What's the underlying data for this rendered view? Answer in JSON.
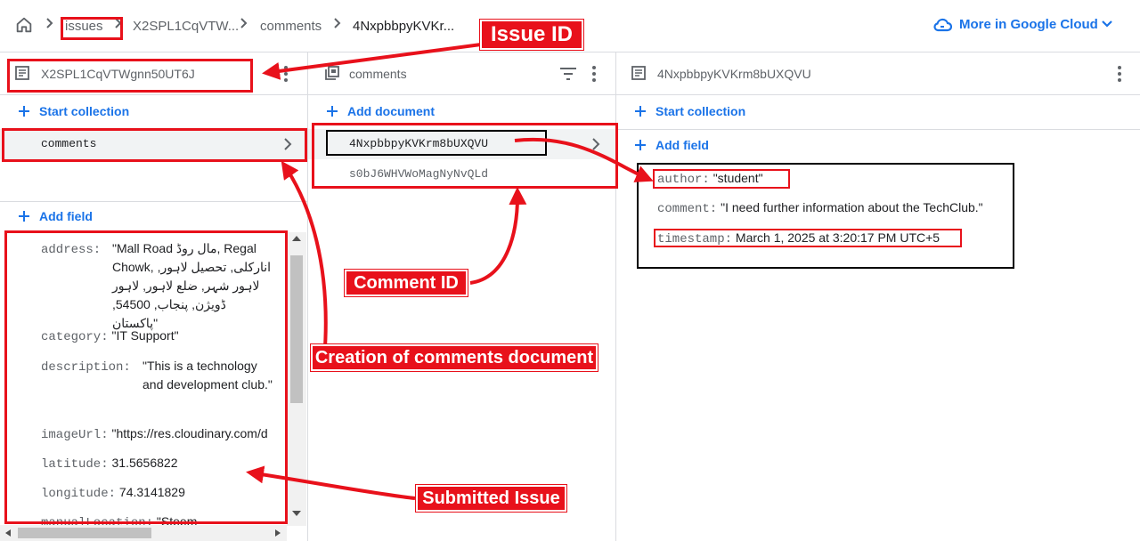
{
  "breadcrumb": {
    "crumbs": [
      "issues",
      "X2SPL1CqVTW...",
      "comments",
      "4NxpbbpyKVKr..."
    ]
  },
  "header": {
    "cloud_link": "More in Google Cloud"
  },
  "panel1": {
    "title": "X2SPL1CqVTWgnn50UT6J",
    "start_collection": "Start collection",
    "collection": "comments",
    "add_field": "Add field",
    "fields": {
      "address_key": "address:",
      "address_value": "\"Mall Road مال روڈ, Regal Chowk, انارکلی, تحصیل لاہور, لاہور شہر, ضلع لاہور, لاہور ڈویژن, پنجاب, 54500, پاکستان\"",
      "category_key": "category:",
      "category_value": "\"IT Support\"",
      "description_key": "description:",
      "description_value": "\"This is a technology and development club.\"",
      "imageUrl_key": "imageUrl:",
      "imageUrl_value": "\"https://res.cloudinary.com/d",
      "latitude_key": "latitude:",
      "latitude_value": "31.5656822",
      "longitude_key": "longitude:",
      "longitude_value": "74.3141829",
      "manualLocation_key": "manualLocation:",
      "manualLocation_value": "\"Steem"
    }
  },
  "panel2": {
    "title": "comments",
    "add_document": "Add document",
    "documents": [
      "4NxpbbpyKVKrm8bUXQVU",
      "s0bJ6WHVWoMagNyNvQLd"
    ]
  },
  "panel3": {
    "title": "4NxpbbpyKVKrm8bUXQVU",
    "start_collection": "Start collection",
    "add_field": "Add field",
    "fields": {
      "author_key": "author:",
      "author_value": "\"student\"",
      "comment_key": "comment:",
      "comment_value": "\"I need further information about the TechClub.\"",
      "timestamp_key": "timestamp:",
      "timestamp_value": "March 1, 2025 at 3:20:17 PM UTC+5"
    }
  },
  "annotations": {
    "issue_id": "Issue ID",
    "comment_id": "Comment ID",
    "creation": "Creation of comments document",
    "submitted": "Submitted Issue"
  },
  "colors": {
    "annotation": "#e8111b",
    "link": "#1a73e8"
  }
}
